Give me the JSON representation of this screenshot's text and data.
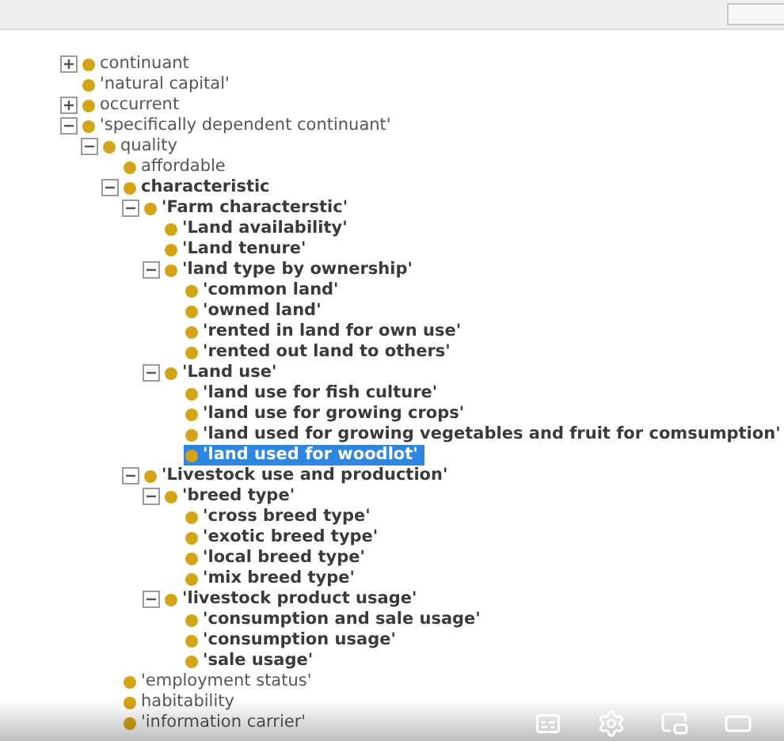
{
  "tree": [
    {
      "label": "continuant",
      "bold": false,
      "expanded": false,
      "selected": false
    },
    {
      "label": "'natural capital'",
      "bold": false,
      "selected": false
    },
    {
      "label": "occurrent",
      "bold": false,
      "expanded": false,
      "selected": false
    },
    {
      "label": "'specifically dependent continuant'",
      "bold": false,
      "expanded": true,
      "selected": false,
      "children": [
        {
          "label": "quality",
          "bold": false,
          "expanded": true,
          "selected": false,
          "children": [
            {
              "label": "affordable",
              "bold": false,
              "selected": false
            },
            {
              "label": "characteristic",
              "bold": true,
              "expanded": true,
              "selected": false,
              "children": [
                {
                  "label": "'Farm characterstic'",
                  "bold": true,
                  "expanded": true,
                  "selected": false,
                  "children": [
                    {
                      "label": "'Land availability'",
                      "bold": true,
                      "selected": false
                    },
                    {
                      "label": "'Land tenure'",
                      "bold": true,
                      "selected": false
                    },
                    {
                      "label": "'land type by ownership'",
                      "bold": true,
                      "expanded": true,
                      "selected": false,
                      "children": [
                        {
                          "label": "'common land'",
                          "bold": true,
                          "selected": false
                        },
                        {
                          "label": "'owned land'",
                          "bold": true,
                          "selected": false
                        },
                        {
                          "label": "'rented in land for own use'",
                          "bold": true,
                          "selected": false
                        },
                        {
                          "label": "'rented out land to others'",
                          "bold": true,
                          "selected": false
                        }
                      ]
                    },
                    {
                      "label": "'Land use'",
                      "bold": true,
                      "expanded": true,
                      "selected": false,
                      "children": [
                        {
                          "label": "'land use for fish culture'",
                          "bold": true,
                          "selected": false
                        },
                        {
                          "label": "'land use for growing crops'",
                          "bold": true,
                          "selected": false
                        },
                        {
                          "label": "'land used for growing vegetables and fruit for comsumption'",
                          "bold": true,
                          "selected": false
                        },
                        {
                          "label": "'land used for woodlot'",
                          "bold": true,
                          "selected": true
                        }
                      ]
                    }
                  ]
                },
                {
                  "label": "'Livestock use and production'",
                  "bold": true,
                  "expanded": true,
                  "selected": false,
                  "children": [
                    {
                      "label": "'breed type'",
                      "bold": true,
                      "expanded": true,
                      "selected": false,
                      "children": [
                        {
                          "label": "'cross breed type'",
                          "bold": true,
                          "selected": false
                        },
                        {
                          "label": "'exotic breed type'",
                          "bold": true,
                          "selected": false
                        },
                        {
                          "label": "'local breed type'",
                          "bold": true,
                          "selected": false
                        },
                        {
                          "label": "'mix breed type'",
                          "bold": true,
                          "selected": false
                        }
                      ]
                    },
                    {
                      "label": "'livestock product usage'",
                      "bold": true,
                      "expanded": true,
                      "selected": false,
                      "children": [
                        {
                          "label": "'consumption and sale usage'",
                          "bold": true,
                          "selected": false
                        },
                        {
                          "label": "'consumption usage'",
                          "bold": true,
                          "selected": false
                        },
                        {
                          "label": "'sale usage'",
                          "bold": true,
                          "selected": false
                        }
                      ]
                    }
                  ]
                }
              ]
            },
            {
              "label": "'employment status'",
              "bold": false,
              "selected": false
            },
            {
              "label": "habitability",
              "bold": false,
              "selected": false
            },
            {
              "label": "'information carrier'",
              "bold": false,
              "selected": false
            }
          ]
        }
      ]
    }
  ]
}
